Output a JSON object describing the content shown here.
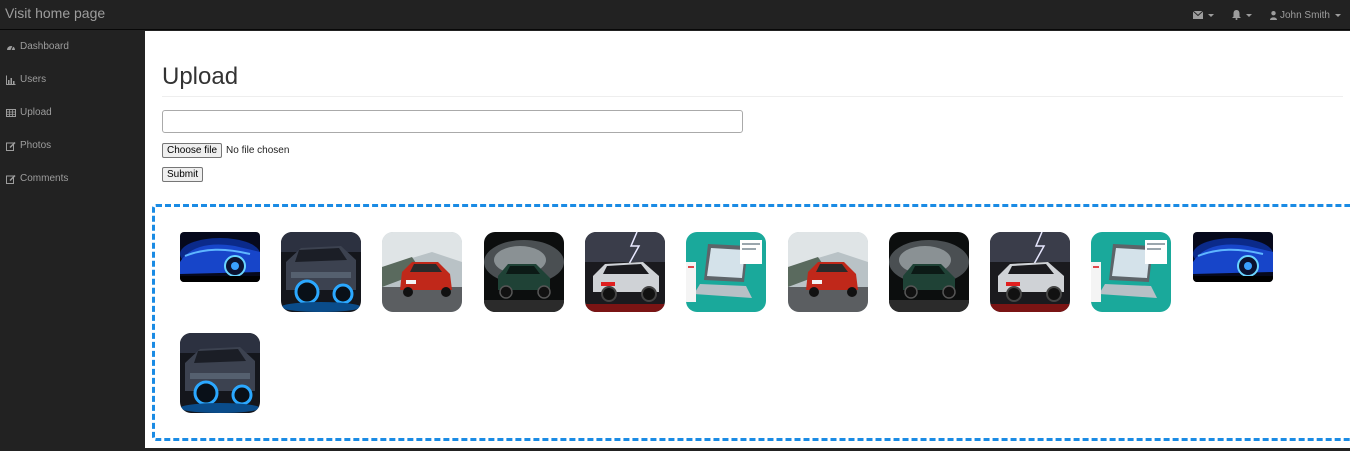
{
  "topbar": {
    "brand": "Visit home page",
    "user_name": "John Smith",
    "icons": [
      "envelope-icon",
      "bell-icon",
      "user-icon"
    ]
  },
  "sidebar": {
    "items": [
      {
        "label": "Dashboard",
        "icon": "dashboard-icon"
      },
      {
        "label": "Users",
        "icon": "bar-chart-icon"
      },
      {
        "label": "Upload",
        "icon": "table-icon"
      },
      {
        "label": "Photos",
        "icon": "edit-icon"
      },
      {
        "label": "Comments",
        "icon": "edit-icon"
      }
    ]
  },
  "main": {
    "title": "Upload",
    "text_input_value": "",
    "choose_file_label": "Choose file",
    "file_status": "No file chosen",
    "submit_label": "Submit"
  },
  "gallery": {
    "border_color": "#1a8be4",
    "images": [
      "blue-sports-car",
      "dark-muscle-car",
      "red-bmw-car",
      "green-mustang-car",
      "lightning-race-car",
      "laptop-illustration",
      "red-bmw-car",
      "green-mustang-car",
      "lightning-race-car",
      "laptop-illustration",
      "blue-sports-car",
      "dark-muscle-car"
    ]
  }
}
